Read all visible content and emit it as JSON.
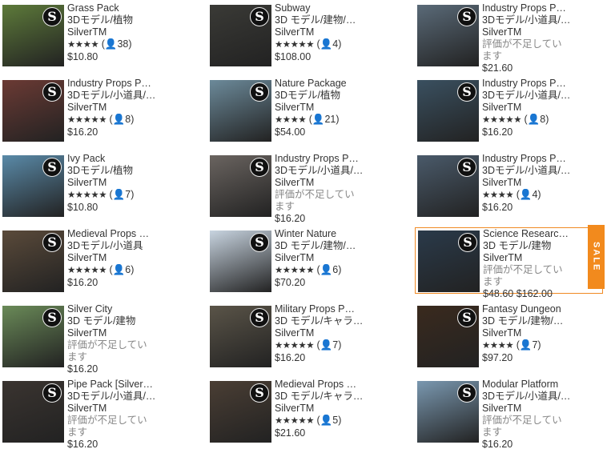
{
  "items": [
    {
      "title": "Grass Pack",
      "category": "3Dモデル/植物",
      "publisher": "SilverTM",
      "stars": "★★★★",
      "count": "(👤38)",
      "rating": true,
      "price": "$10.80",
      "bg": "#5d7a3a"
    },
    {
      "title": "Subway",
      "category": "3D モデル/建物/…",
      "publisher": "SilverTM",
      "stars": "★★★★★",
      "count": "(👤4)",
      "rating": true,
      "price": "$108.00",
      "bg": "#3a3a36"
    },
    {
      "title": "Industry Props P…",
      "category": "3Dモデル/小道具/…",
      "publisher": "SilverTM",
      "norate": "評価が不足しています",
      "rating": false,
      "price": "$21.60",
      "bg": "#5a6a78"
    },
    {
      "title": "Industry Props P…",
      "category": "3Dモデル/小道具/…",
      "publisher": "SilverTM",
      "stars": "★★★★★",
      "count": "(👤8)",
      "rating": true,
      "price": "$16.20",
      "bg": "#6b3a34"
    },
    {
      "title": "Nature Package",
      "category": "3Dモデル/植物",
      "publisher": "SilverTM",
      "stars": "★★★★",
      "count": "(👤21)",
      "rating": true,
      "price": "$54.00",
      "bg": "#6c8a9a"
    },
    {
      "title": "Industry Props P…",
      "category": "3Dモデル/小道具/…",
      "publisher": "SilverTM",
      "stars": "★★★★★",
      "count": "(👤8)",
      "rating": true,
      "price": "$16.20",
      "bg": "#3a5060"
    },
    {
      "title": "Ivy Pack",
      "category": "3Dモデル/植物",
      "publisher": "SilverTM",
      "stars": "★★★★★",
      "count": "(👤7)",
      "rating": true,
      "price": "$10.80",
      "bg": "#5a8aa8"
    },
    {
      "title": "Industry Props P…",
      "category": "3Dモデル/小道具/…",
      "publisher": "SilverTM",
      "norate": "評価が不足しています",
      "rating": false,
      "price": "$16.20",
      "bg": "#6a6460"
    },
    {
      "title": "Industry Props P…",
      "category": "3Dモデル/小道具/…",
      "publisher": "SilverTM",
      "stars": "★★★★",
      "count": "(👤4)",
      "rating": true,
      "price": "$16.20",
      "bg": "#4a5a6a"
    },
    {
      "title": "Medieval Props …",
      "category": "3Dモデル/小道具",
      "publisher": "SilverTM",
      "stars": "★★★★★",
      "count": "(👤6)",
      "rating": true,
      "price": "$16.20",
      "bg": "#5a4a3a"
    },
    {
      "title": "Winter Nature",
      "category": "3D モデル/建物/…",
      "publisher": "SilverTM",
      "stars": "★★★★★",
      "count": "(👤6)",
      "rating": true,
      "price": "$70.20",
      "bg": "#c8d4e0"
    },
    {
      "title": "Science Researc…",
      "category": "3D モデル/建物",
      "publisher": "SilverTM",
      "norate": "評価が不足しています",
      "rating": false,
      "price": "$48.60 $162.00",
      "bg": "#2a3a4a",
      "sale": "SALE"
    },
    {
      "title": "Silver City",
      "category": "3D モデル/建物",
      "publisher": "SilverTM",
      "norate": "評価が不足しています",
      "rating": false,
      "price": "$16.20",
      "bg": "#6a8a58"
    },
    {
      "title": "Military Props P…",
      "category": "3D モデル/キャラ…",
      "publisher": "SilverTM",
      "stars": "★★★★★",
      "count": "(👤7)",
      "rating": true,
      "price": "$16.20",
      "bg": "#5a5448"
    },
    {
      "title": "Fantasy Dungeon",
      "category": "3D モデル/建物/…",
      "publisher": "SilverTM",
      "stars": "★★★★",
      "count": "(👤7)",
      "rating": true,
      "price": "$97.20",
      "bg": "#3a2a1e"
    },
    {
      "title": "Pipe Pack [Silver…",
      "category": "3Dモデル/小道具/…",
      "publisher": "SilverTM",
      "norate": "評価が不足しています",
      "rating": false,
      "price": "$16.20",
      "bg": "#3a3430"
    },
    {
      "title": "Medieval Props …",
      "category": "3D モデル/キャラ…",
      "publisher": "SilverTM",
      "stars": "★★★★★",
      "count": "(👤5)",
      "rating": true,
      "price": "$21.60",
      "bg": "#4a3e34"
    },
    {
      "title": "Modular Platform",
      "category": "3Dモデル/小道具/…",
      "publisher": "SilverTM",
      "norate": "評価が不足しています",
      "rating": false,
      "price": "$16.20",
      "bg": "#7a98b0"
    }
  ]
}
